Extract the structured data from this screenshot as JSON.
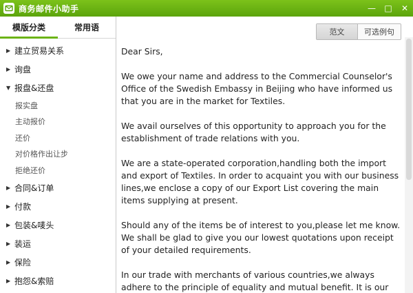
{
  "window": {
    "title": "商务邮件小助手",
    "controls": {
      "minimize": "—",
      "maximize": "□",
      "close": "✕"
    },
    "accent": "#6bb315"
  },
  "sidebar": {
    "tabs": [
      {
        "label": "模版分类",
        "active": true
      },
      {
        "label": "常用语",
        "active": false
      }
    ],
    "tree": {
      "item0": "建立贸易关系",
      "item1": "询盘",
      "item2": "报盘&还盘",
      "item2_children": [
        "报实盘",
        "主动报价",
        "还价",
        "对价格作出让步",
        "拒绝还价"
      ],
      "item3": "合同&订单",
      "item4": "付款",
      "item5": "包装&唛头",
      "item6": "装运",
      "item7": "保险",
      "item8": "抱怨&索赔"
    }
  },
  "main": {
    "toggle": {
      "original": "范文",
      "optional": "可选例句"
    },
    "letter": {
      "greeting": "Dear Sirs,",
      "p1": "We owe  your name and address to the Commercial  Counselor's Office of the Swedish Embassy in Beijing who have informed us that you are in the market for Textiles.",
      "p2": "We avail ourselves of this opportunity to approach  you for the establishment of trade relations with you.",
      "p3": "We are a state-operated corporation,handling both the import and export of Textiles. In order to acquaint you with our business lines,we enclose a copy of our Export List covering the main items supplying at present.",
      "p4": "Should any of the items be of interest to you,please let me know. We shall be glad to give you our lowest quotations upon receipt of your detailed requirements.",
      "p5": "In our trade with merchants of various countries,we always adhere to the principle of equality and mutual benefit. It is our hope to"
    }
  }
}
